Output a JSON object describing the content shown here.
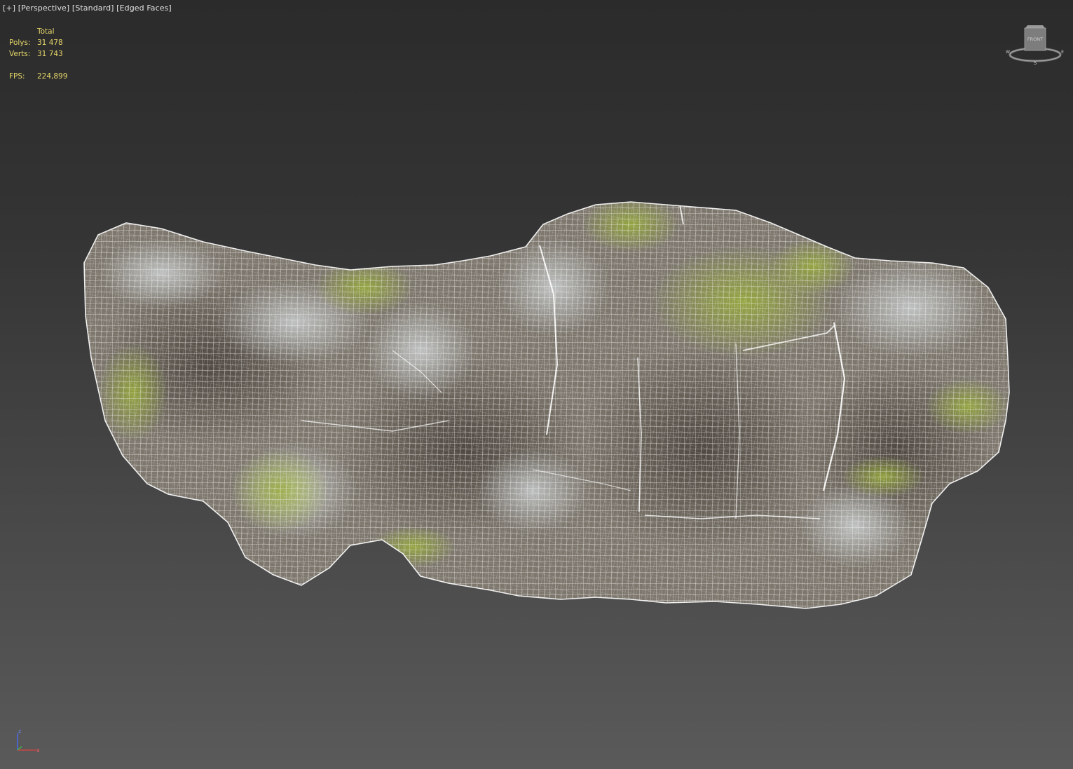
{
  "viewport": {
    "plus_label": "[+]",
    "view_label": "[Perspective]",
    "shading_label": "[Standard]",
    "display_label": "[Edged Faces]"
  },
  "stats": {
    "header": "Total",
    "polys_label": "Polys:",
    "polys_value": "31 478",
    "verts_label": "Verts:",
    "verts_value": "31 743",
    "fps_label": "FPS:",
    "fps_value": "224,899"
  },
  "viewcube": {
    "face_label": "FRONT",
    "compass_s": "S",
    "compass_w": "W",
    "compass_e": "E"
  },
  "axis": {
    "z": "z",
    "x": "x"
  },
  "colors": {
    "stats_text": "#e8d86a",
    "wire": "#ffffff",
    "rock": "#8a8479",
    "moss": "#8a9a3a",
    "axis_z": "#4a6cff",
    "axis_x": "#e04040",
    "axis_y": "#40c040"
  }
}
